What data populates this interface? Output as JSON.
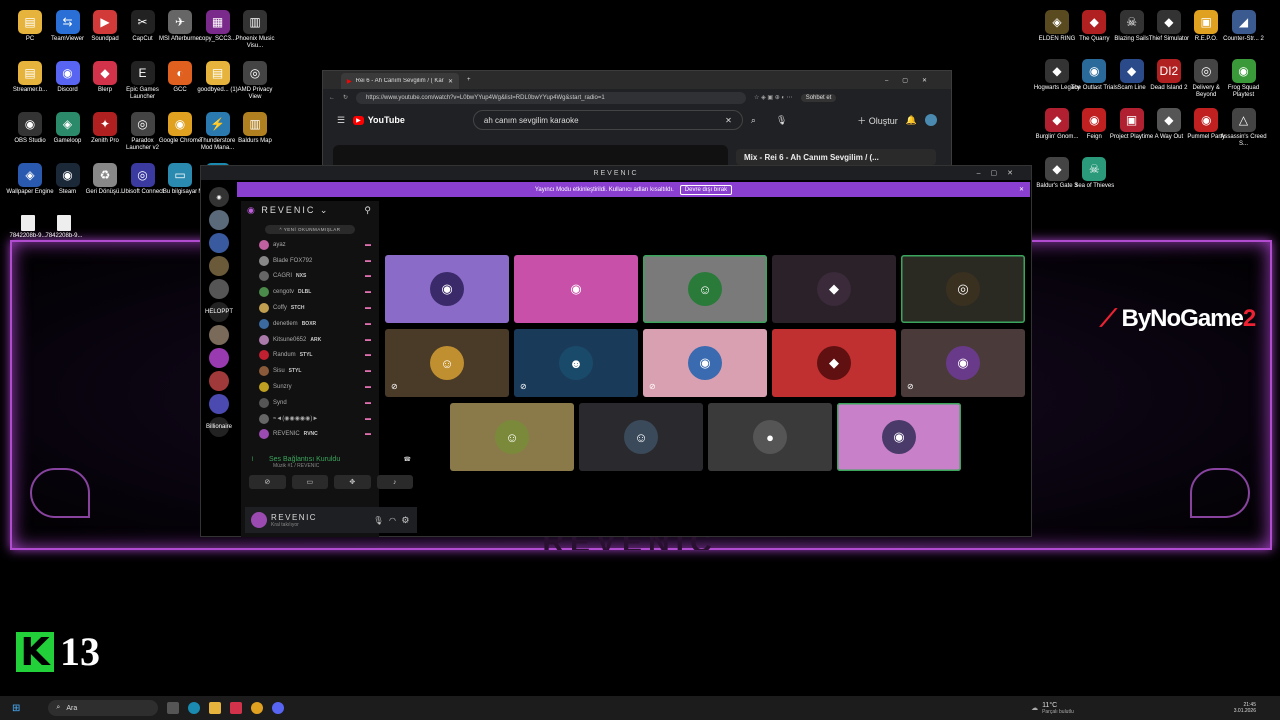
{
  "desktop": {
    "left_icons": [
      {
        "label": "PC",
        "color": "#e6b43c",
        "glyph": "▤"
      },
      {
        "label": "TeamViewer",
        "color": "#2a6fd6",
        "glyph": "⇆"
      },
      {
        "label": "Soundpad",
        "color": "#d23a3a",
        "glyph": "▶"
      },
      {
        "label": "CapCut",
        "color": "#222",
        "glyph": "✂"
      },
      {
        "label": "MSI Afterburner",
        "color": "#666",
        "glyph": "✈"
      },
      {
        "label": "copy_SCC3...",
        "color": "#7a2a8a",
        "glyph": "▦"
      },
      {
        "label": "Phoenix Music Visu...",
        "color": "#333",
        "glyph": "▥"
      },
      {
        "label": "Streamer.b...",
        "color": "#e6b43c",
        "glyph": "▤"
      },
      {
        "label": "Discord",
        "color": "#5865f2",
        "glyph": "◉"
      },
      {
        "label": "Blerp",
        "color": "#d2334a",
        "glyph": "◆"
      },
      {
        "label": "Epic Games Launcher",
        "color": "#222",
        "glyph": "E"
      },
      {
        "label": "GCC",
        "color": "#e06020",
        "glyph": "◐"
      },
      {
        "label": "goodbyed... (1)",
        "color": "#e6b43c",
        "glyph": "▤"
      },
      {
        "label": "AMD Privacy View",
        "color": "#444",
        "glyph": "◎"
      },
      {
        "label": "OBS Studio",
        "color": "#333",
        "glyph": "◉"
      },
      {
        "label": "Gameloop",
        "color": "#2a8a6a",
        "glyph": "◈"
      },
      {
        "label": "Zenith Pro",
        "color": "#b02020",
        "glyph": "✦"
      },
      {
        "label": "Paradox Launcher v2",
        "color": "#444",
        "glyph": "◎"
      },
      {
        "label": "Google Chrome",
        "color": "#e0a020",
        "glyph": "◉"
      },
      {
        "label": "Thunderstore Mod Mana...",
        "color": "#2a7ab0",
        "glyph": "⚡"
      },
      {
        "label": "Baldurs Map",
        "color": "#b08020",
        "glyph": "▥"
      },
      {
        "label": "Wallpaper Engine",
        "color": "#2a5ab0",
        "glyph": "◈"
      },
      {
        "label": "Steam",
        "color": "#1b2838",
        "glyph": "◉"
      },
      {
        "label": "Geri Dönüşü...",
        "color": "#888",
        "glyph": "♻"
      },
      {
        "label": "Ubisoft Connect",
        "color": "#3a3aa0",
        "glyph": "◎"
      },
      {
        "label": "Bu bilgisayar",
        "color": "#2a8ab0",
        "glyph": "▭"
      },
      {
        "label": "Microsoft Ed...",
        "color": "#1a8ab0",
        "glyph": "◐"
      },
      {
        "label": "7842208b-9...",
        "color": "#eee",
        "glyph": "▭"
      },
      {
        "label": "7842208b-9...",
        "color": "#eee",
        "glyph": "▭"
      }
    ],
    "right_icons": [
      {
        "label": "ELDEN RING",
        "color": "#5a4a20",
        "glyph": "◈"
      },
      {
        "label": "The Quarry",
        "color": "#b02020",
        "glyph": "◆"
      },
      {
        "label": "Blazing Sails",
        "color": "#333",
        "glyph": "☠"
      },
      {
        "label": "Thief Simulator",
        "color": "#333",
        "glyph": "◆"
      },
      {
        "label": "R.E.P.O.",
        "color": "#e0a020",
        "glyph": "▣"
      },
      {
        "label": "Counter-Str... 2",
        "color": "#3a5a90",
        "glyph": "◢"
      },
      {
        "label": "Hogwarts Legacy",
        "color": "#333",
        "glyph": "◆"
      },
      {
        "label": "The Outlast Trials",
        "color": "#2a6a9a",
        "glyph": "◉"
      },
      {
        "label": "Scam Line",
        "color": "#2a4a8a",
        "glyph": "◆"
      },
      {
        "label": "Dead Island 2",
        "color": "#b02020",
        "glyph": "DI2"
      },
      {
        "label": "Delivery & Beyond",
        "color": "#444",
        "glyph": "◎"
      },
      {
        "label": "Frog Squad Playtest",
        "color": "#3a9a3a",
        "glyph": "◉"
      },
      {
        "label": "Burglin' Gnom...",
        "color": "#b02030",
        "glyph": "◆"
      },
      {
        "label": "Feign",
        "color": "#c02020",
        "glyph": "◉"
      },
      {
        "label": "Project Playtime",
        "color": "#b02030",
        "glyph": "▣"
      },
      {
        "label": "A Way Out",
        "color": "#555",
        "glyph": "◆"
      },
      {
        "label": "Pummel Party",
        "color": "#c02020",
        "glyph": "◉"
      },
      {
        "label": "Assassin's Creed S...",
        "color": "#444",
        "glyph": "△"
      },
      {
        "label": "Baldur's Gate 3",
        "color": "#444",
        "glyph": "◆"
      },
      {
        "label": "Sea of Thieves",
        "color": "#2a9a7a",
        "glyph": "☠"
      }
    ],
    "wallpaper_logo_a": "ByNoGame",
    "wallpaper_logo_b": "2",
    "wallpaper_bottom_text": "REVENIC",
    "k13_number": "13",
    "k13_letter": "K"
  },
  "browser": {
    "tab_title": "Rei 6 - Ah Canım Sevgilim / ( Kara",
    "url": "https://www.youtube.com/watch?v=L0bwYYup4Wg&list=RDL0bwYYup4Wg&start_radio=1",
    "chat_button": "Sohbet et",
    "yt_logo": "YouTube",
    "search_value": "ah canım sevgilim karaoke",
    "create_label": "Oluştur",
    "mix_title": "Mix - Rei 6 - Ah Canım Sevgilim / (..."
  },
  "discord": {
    "window_title": "REVENIC",
    "banner_text": "Yayıncı Modu etkinleştirildi. Kullanıcı adları kısaltıldı.",
    "banner_button": "Devre dışı bırak",
    "server_name": "REVENIC",
    "unread_label": "^ YENİ OKUNMAMIŞLAR",
    "members": [
      {
        "name": "ayaz",
        "tag": "",
        "color": "#c060a0"
      },
      {
        "name": "Blade FOX792",
        "tag": "",
        "color": "#888"
      },
      {
        "name": "CAGRI",
        "tag": "NXS",
        "color": "#666"
      },
      {
        "name": "cengotv",
        "tag": "DLBL",
        "color": "#4a8a4a"
      },
      {
        "name": "Coffy",
        "tag": "STCH",
        "color": "#c0a050"
      },
      {
        "name": "denetlem",
        "tag": "BOXR",
        "color": "#3a6aa0"
      },
      {
        "name": "Kitsune0652",
        "tag": "ARK",
        "color": "#aa7aaa"
      },
      {
        "name": "Randum",
        "tag": "STYL",
        "color": "#c02030"
      },
      {
        "name": "Sisu",
        "tag": "STYL",
        "color": "#8a5a3a"
      },
      {
        "name": "Sunzry",
        "tag": "",
        "color": "#c0a020"
      },
      {
        "name": "Synd",
        "tag": "",
        "color": "#555"
      },
      {
        "name": "≈◄(◉◉◉◉◉)►",
        "tag": "",
        "color": "#666"
      },
      {
        "name": "REVENIC",
        "tag": "RVNC",
        "color": "#9a4ab0"
      }
    ],
    "voice_status": "Ses Bağlantısı Kuruldu",
    "voice_channel": "Müzik #1 / REVENIC",
    "user_name": "REVENIC",
    "user_status": "Kral takılıyor",
    "servers": [
      "",
      "",
      "",
      "",
      "HELOPPT",
      "",
      "",
      "",
      "",
      "Billionaire"
    ],
    "tiles": [
      {
        "bg": "#8a6cc8",
        "av": "#3a2a6a",
        "glyph": "◉",
        "mute": false,
        "border": ""
      },
      {
        "bg": "#c850a8",
        "av": "transparent",
        "glyph": "◉",
        "mute": false,
        "border": ""
      },
      {
        "bg": "#7a7a7a",
        "av": "#2a7a3a",
        "glyph": "☺",
        "mute": false,
        "border": "#3ba55c"
      },
      {
        "bg": "#2a2228",
        "av": "#3a2a3a",
        "glyph": "◆",
        "mute": false,
        "border": ""
      },
      {
        "bg": "#2a2a22",
        "av": "#3a3020",
        "glyph": "◎",
        "mute": false,
        "border": "#3ba55c"
      },
      {
        "bg": "#4a3a28",
        "av": "#c09030",
        "glyph": "☺",
        "mute": true,
        "border": ""
      },
      {
        "bg": "#1a3a5a",
        "av": "#1a4a6a",
        "glyph": "☻",
        "mute": true,
        "border": ""
      },
      {
        "bg": "#d8a0b0",
        "av": "#3a6ab0",
        "glyph": "◉",
        "mute": true,
        "border": ""
      },
      {
        "bg": "#c03030",
        "av": "#601010",
        "glyph": "◆",
        "mute": false,
        "border": ""
      },
      {
        "bg": "#4a3a3a",
        "av": "#6a3a8a",
        "glyph": "◉",
        "mute": true,
        "border": ""
      },
      {
        "bg": "#8a7a4a",
        "av": "#7a8a3a",
        "glyph": "☺",
        "mute": false,
        "border": ""
      },
      {
        "bg": "#2a2a2e",
        "av": "#3a4a5a",
        "glyph": "☺",
        "mute": false,
        "border": ""
      },
      {
        "bg": "#3a3a3a",
        "av": "#555",
        "glyph": "●",
        "mute": false,
        "border": ""
      },
      {
        "bg": "#c880c8",
        "av": "#4a3a6a",
        "glyph": "◉",
        "mute": false,
        "border": "#3ba55c"
      }
    ]
  },
  "taskbar": {
    "search_placeholder": "Ara",
    "weather": "11°C",
    "weather_sub": "Parçalı bulutlu",
    "time": "21:45",
    "date": "3.01.2026"
  }
}
